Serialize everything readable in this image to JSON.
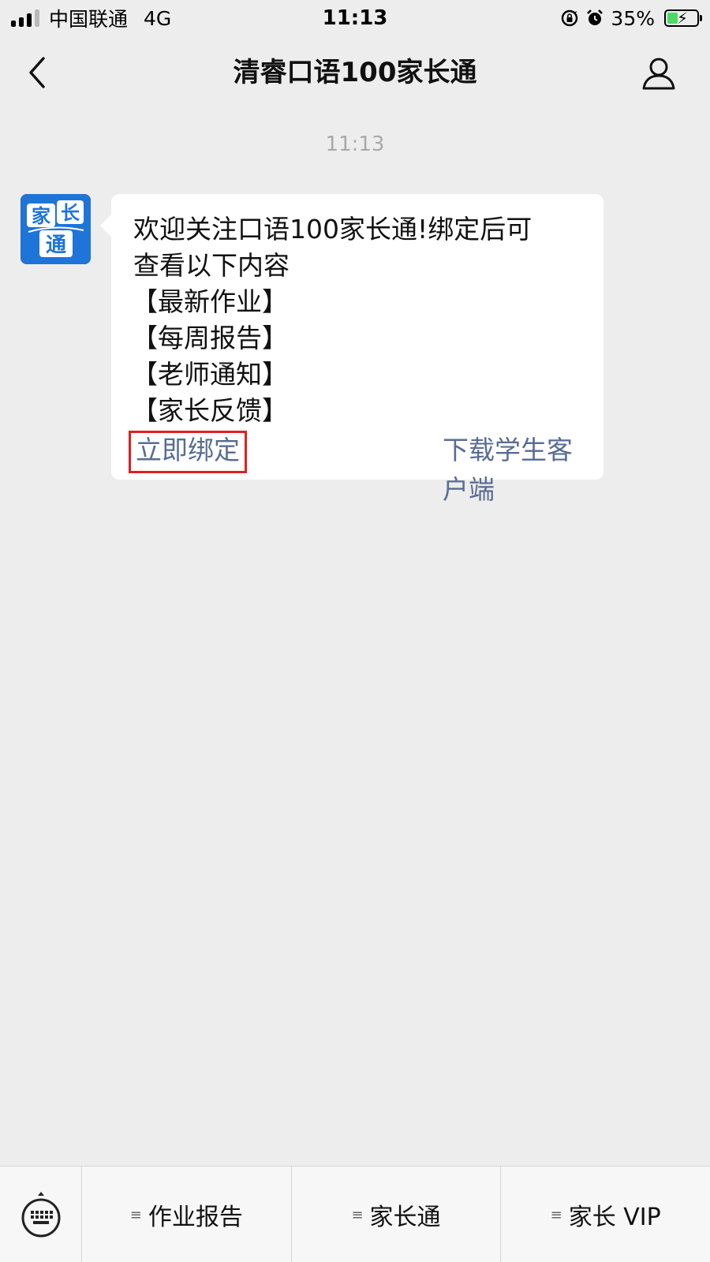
{
  "status_bar": {
    "carrier": "中国联通",
    "network": "4G",
    "time": "11:13",
    "battery": "35%",
    "battery_level": 0.35,
    "signal_bars": 3
  },
  "nav": {
    "back_icon": "chevron-left-icon",
    "title": "清睿口语100家长通",
    "profile_icon": "person-icon"
  },
  "chat": {
    "timestamp": "11:13",
    "avatar_icon": "家长通-logo",
    "message": {
      "line1": "欢迎关注口语100家长通!绑定后可",
      "line2": "查看以下内容",
      "items": [
        "【最新作业】",
        "【每周报告】",
        "【老师通知】",
        "【家长反馈】"
      ],
      "link_bind": "立即绑定",
      "link_download": "下载学生客户端"
    }
  },
  "bottom_menu": {
    "keyboard_icon": "keyboard-icon",
    "items": [
      {
        "label": "作业报告"
      },
      {
        "label": "家长通"
      },
      {
        "label": "家长 VIP"
      }
    ]
  },
  "colors": {
    "background": "#ededed",
    "link": "#586c94",
    "highlight_box": "#e02020",
    "battery_fill": "#4cd964",
    "logo_blue": "#1f74d8"
  }
}
